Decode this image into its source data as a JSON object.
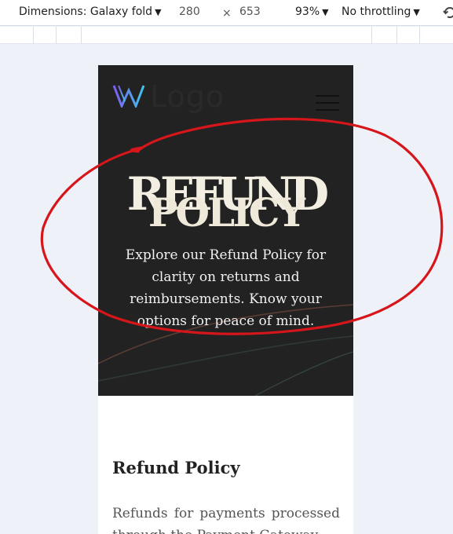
{
  "devtools": {
    "device_label": "Dimensions: Galaxy fold",
    "width": "280",
    "times": "×",
    "height": "653",
    "zoom": "93%",
    "throttling": "No throttling",
    "caret": "▼"
  },
  "site": {
    "logo_text": "Logo",
    "hero_title_line1": "REFUND",
    "hero_title_line2": "POLICY",
    "hero_description": "Explore our Refund Policy for clarity on returns and reimbursements. Know your options for peace of mind.",
    "section_title": "Refund Policy",
    "section_body": "Refunds for payments processed through the Payment Gateway"
  },
  "colors": {
    "hero_bg": "#222222",
    "annotation": "#d6161b",
    "logo_gradient_start": "#7d5cf0",
    "logo_gradient_end": "#3ec6e8"
  }
}
